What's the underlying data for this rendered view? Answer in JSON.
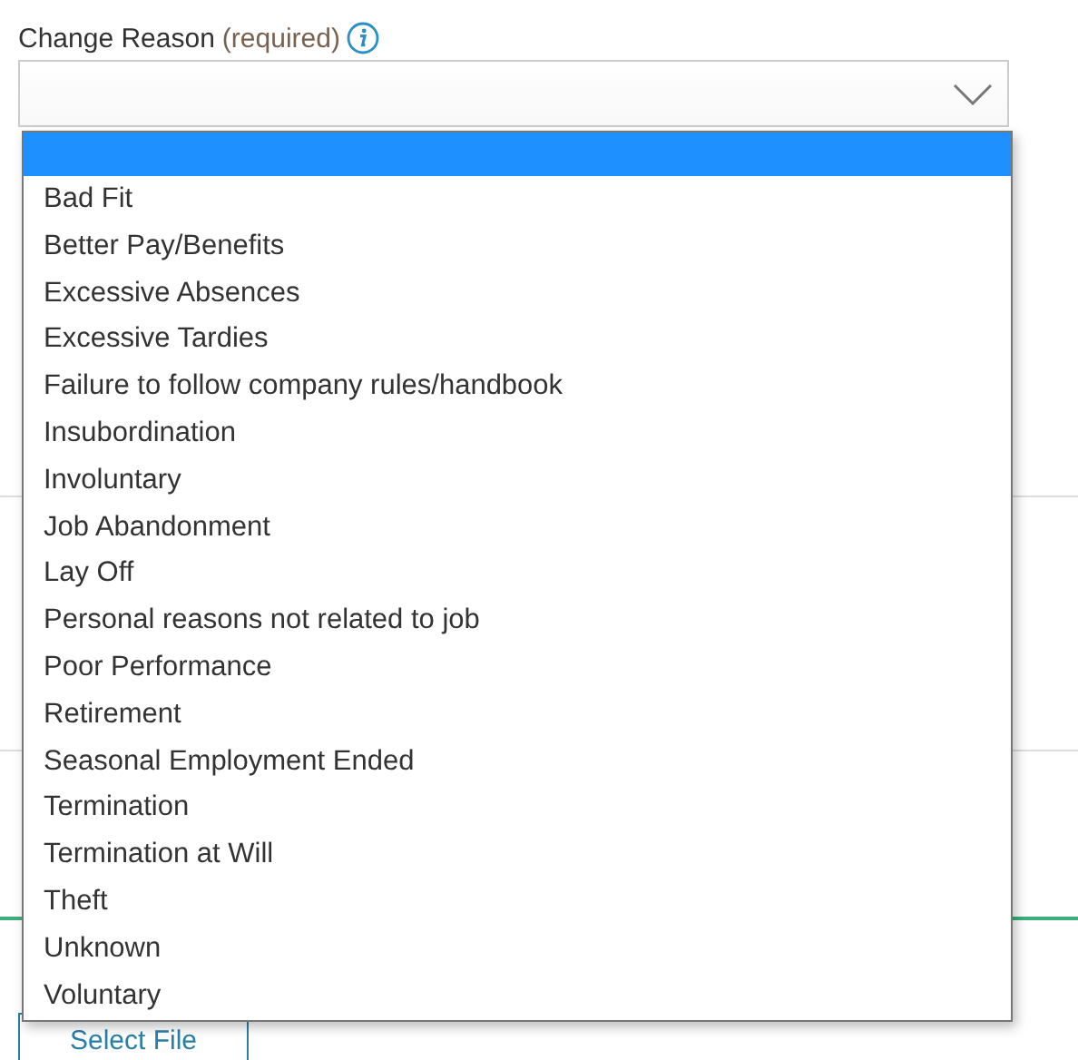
{
  "field": {
    "label": "Change Reason",
    "hint": "(required)"
  },
  "dropdown": {
    "options": [
      {
        "selected": true
      },
      {
        "label": "Bad Fit",
        "selected": false
      },
      {
        "label": "Better Pay/Benefits",
        "selected": false
      },
      {
        "label": "Excessive Absences",
        "selected": false
      },
      {
        "label": "Excessive Tardies",
        "selected": false
      },
      {
        "label": "Failure to follow company rules/handbook",
        "selected": false
      },
      {
        "label": "Insubordination",
        "selected": false
      },
      {
        "label": "Involuntary",
        "selected": false
      },
      {
        "label": "Job Abandonment",
        "selected": false
      },
      {
        "label": "Lay Off",
        "selected": false
      },
      {
        "label": "Personal reasons not related to job",
        "selected": false
      },
      {
        "label": "Poor Performance",
        "selected": false
      },
      {
        "label": "Retirement",
        "selected": false
      },
      {
        "label": "Seasonal Employment Ended",
        "selected": false
      },
      {
        "label": "Termination",
        "selected": false
      },
      {
        "label": "Termination at Will",
        "selected": false
      },
      {
        "label": "Theft",
        "selected": false
      },
      {
        "label": "Unknown",
        "selected": false
      },
      {
        "label": "Voluntary",
        "selected": false
      }
    ]
  },
  "upload": {
    "button": "Select File"
  }
}
